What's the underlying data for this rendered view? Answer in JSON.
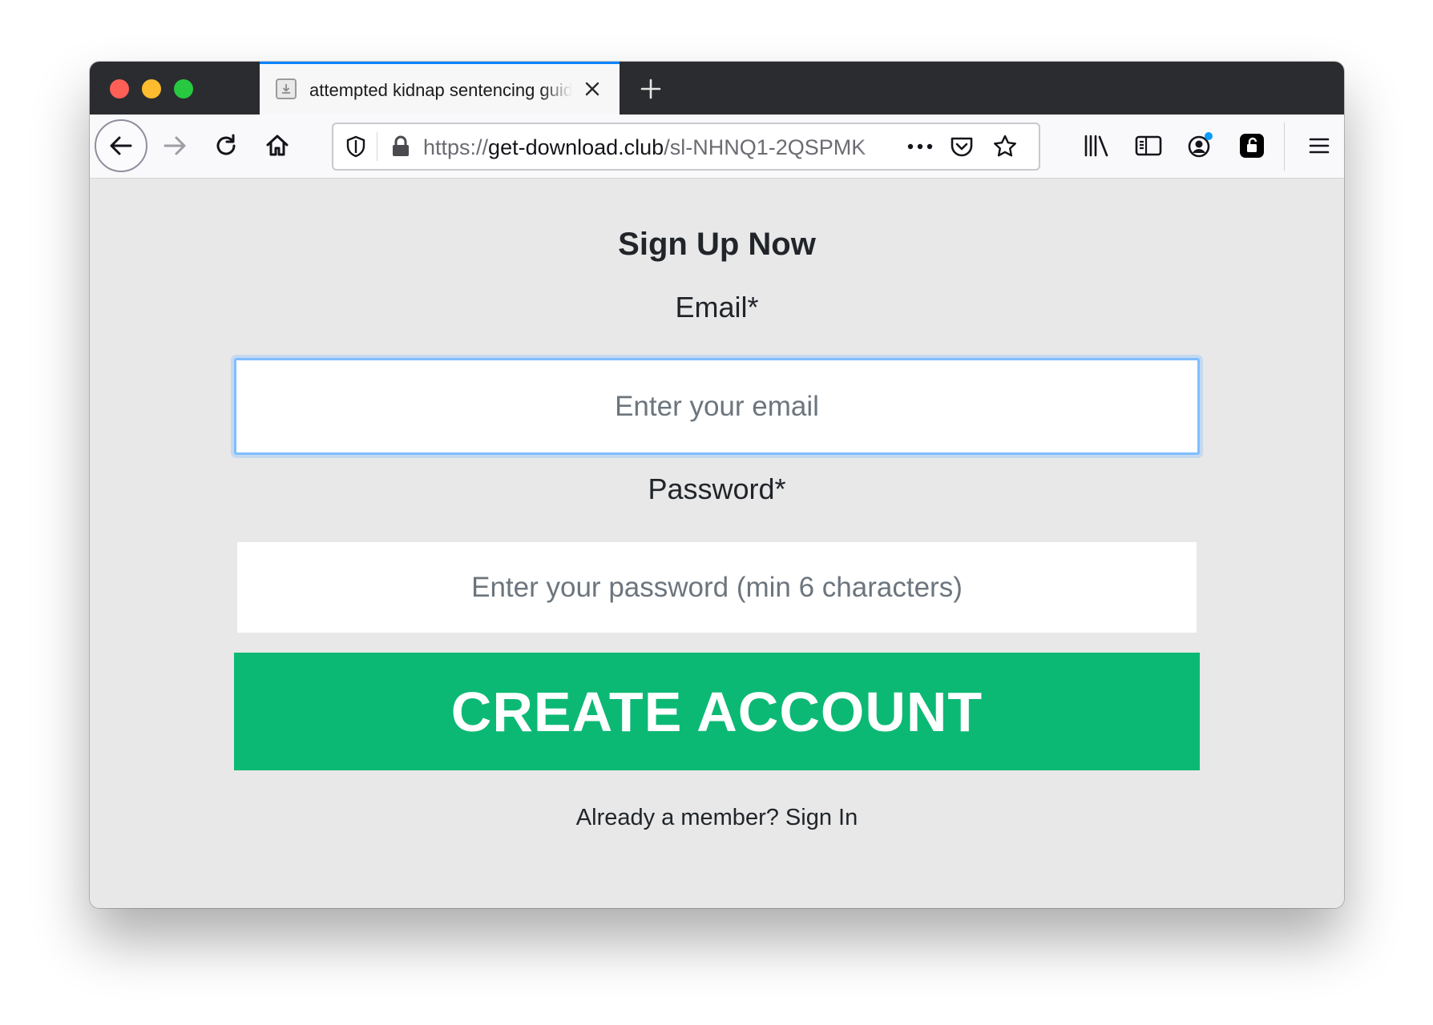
{
  "browser": {
    "tab": {
      "title": "attempted kidnap sentencing guidelines - get-download.club"
    },
    "urlbar": {
      "scheme": "https://",
      "host": "get-download.club",
      "path": "/sl-NHNQ1-2QSPMK"
    },
    "icons": {
      "tab_favicon": "download-icon",
      "tab_close": "close-icon",
      "new_tab": "plus-icon",
      "back": "arrow-left-icon",
      "forward": "arrow-right-icon",
      "reload": "reload-icon",
      "home": "home-icon",
      "tracking_protection": "shield-icon",
      "lock": "lock-icon",
      "page_actions": "more-horizontal-icon",
      "pocket": "pocket-icon",
      "bookmark": "star-icon",
      "library": "library-icon",
      "sidebar": "sidebar-icon",
      "account": "account-icon",
      "extension": "extension-lock-icon",
      "menu": "hamburger-menu-icon"
    },
    "colors": {
      "tab_accent": "#0a84ff",
      "account_badge": "#0a9dff"
    }
  },
  "page": {
    "heading": "Sign Up Now",
    "email_label": "Email*",
    "email_placeholder": "Enter your email",
    "password_label": "Password*",
    "password_placeholder": "Enter your password (min 6 characters)",
    "submit_label": "CREATE ACCOUNT",
    "signin_text": "Already a member? Sign In",
    "colors": {
      "background": "#e8e8e8",
      "button": "#0cb974",
      "focus_ring": "#80bdff"
    }
  }
}
